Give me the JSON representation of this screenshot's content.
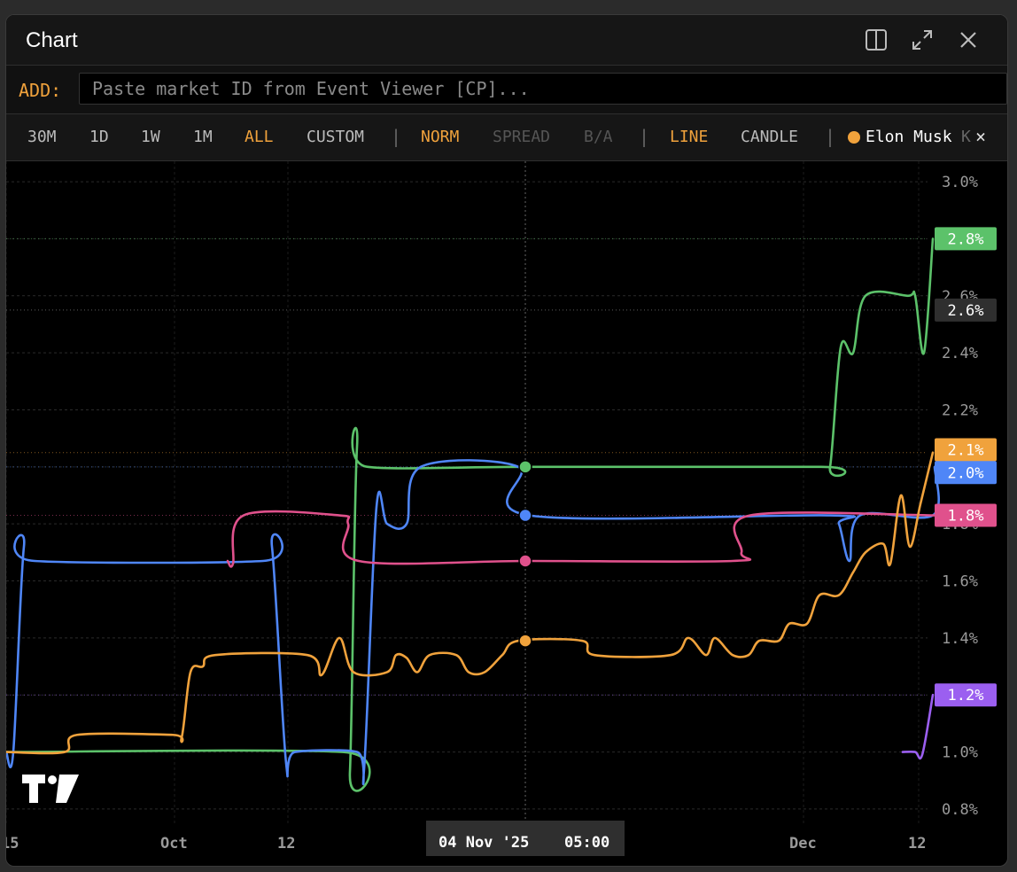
{
  "window": {
    "title": "Chart"
  },
  "icons": {
    "split": "split-view-icon",
    "expand": "expand-icon",
    "close": "close-icon"
  },
  "add_bar": {
    "label": "ADD:",
    "placeholder": "Paste market ID from Event Viewer [CP]..."
  },
  "toolbar": {
    "ranges": [
      "30M",
      "1D",
      "1W",
      "1M",
      "ALL",
      "CUSTOM"
    ],
    "active_range": "ALL",
    "modes": [
      "NORM",
      "SPREAD",
      "B/A"
    ],
    "active_mode": "NORM",
    "styles": [
      "LINE",
      "CANDLE"
    ],
    "active_style": "LINE",
    "separator": "|",
    "market_chip": {
      "label": "Elon Musk",
      "extra": "K",
      "close": "×",
      "color": "#f0a23c"
    }
  },
  "chart_data": {
    "type": "line",
    "y_unit": "%",
    "ylim": [
      0.75,
      3.05
    ],
    "y_ticks": [
      "3.0%",
      "2.8%",
      "2.6%",
      "2.4%",
      "2.2%",
      "2.0%",
      "1.8%",
      "1.6%",
      "1.4%",
      "1.2%",
      "1.0%",
      "0.8%"
    ],
    "x_ticks": [
      "15",
      "Oct",
      "12",
      "Dec",
      "12"
    ],
    "grid": true,
    "crosshair_label": {
      "date": "04 Nov '25",
      "time": "05:00"
    },
    "logo": "TV",
    "series": [
      {
        "color": "#5cc26a",
        "last_label": "2.8%",
        "points": [
          [
            0,
            1.0
          ],
          [
            380,
            1.0
          ],
          [
            388,
            0.93
          ],
          [
            396,
            2.07
          ],
          [
            408,
            2.0
          ],
          [
            590,
            2.0
          ],
          [
            920,
            2.0
          ],
          [
            930,
            2.0
          ],
          [
            942,
            2.42
          ],
          [
            956,
            2.4
          ],
          [
            970,
            2.6
          ],
          [
            1018,
            2.6
          ],
          [
            1026,
            2.6
          ],
          [
            1036,
            2.4
          ],
          [
            1046,
            2.8
          ]
        ]
      },
      {
        "color": "#4f86f7",
        "last_label": "2.0%",
        "points": [
          [
            0,
            1.0
          ],
          [
            8,
            1.0
          ],
          [
            20,
            1.72
          ],
          [
            32,
            1.67
          ],
          [
            290,
            1.67
          ],
          [
            300,
            1.72
          ],
          [
            316,
            0.96
          ],
          [
            326,
            1.0
          ],
          [
            396,
            1.0
          ],
          [
            404,
            0.94
          ],
          [
            418,
            1.86
          ],
          [
            430,
            1.8
          ],
          [
            452,
            1.8
          ],
          [
            468,
            2.0
          ],
          [
            578,
            2.0
          ],
          [
            590,
            1.83
          ],
          [
            930,
            1.83
          ],
          [
            940,
            1.8
          ],
          [
            952,
            1.67
          ],
          [
            964,
            1.83
          ],
          [
            1046,
            1.83
          ],
          [
            1048,
            2.0
          ]
        ]
      },
      {
        "color": "#e0518c",
        "last_label": "1.8%",
        "points": [
          [
            250,
            1.67
          ],
          [
            256,
            1.66
          ],
          [
            268,
            1.83
          ],
          [
            376,
            1.83
          ],
          [
            386,
            1.8
          ],
          [
            398,
            1.67
          ],
          [
            590,
            1.67
          ],
          [
            820,
            1.67
          ],
          [
            830,
            1.7
          ],
          [
            840,
            1.83
          ],
          [
            1048,
            1.83
          ]
        ]
      },
      {
        "color": "#f0a23c",
        "last_label": "2.1%",
        "points": [
          [
            0,
            1.0
          ],
          [
            66,
            1.0
          ],
          [
            80,
            1.06
          ],
          [
            188,
            1.06
          ],
          [
            198,
            1.05
          ],
          [
            208,
            1.28
          ],
          [
            222,
            1.3
          ],
          [
            236,
            1.34
          ],
          [
            340,
            1.34
          ],
          [
            356,
            1.27
          ],
          [
            376,
            1.4
          ],
          [
            392,
            1.28
          ],
          [
            430,
            1.28
          ],
          [
            440,
            1.34
          ],
          [
            452,
            1.33
          ],
          [
            464,
            1.28
          ],
          [
            478,
            1.34
          ],
          [
            508,
            1.34
          ],
          [
            522,
            1.28
          ],
          [
            540,
            1.28
          ],
          [
            560,
            1.34
          ],
          [
            578,
            1.39
          ],
          [
            650,
            1.39
          ],
          [
            664,
            1.34
          ],
          [
            750,
            1.34
          ],
          [
            770,
            1.4
          ],
          [
            790,
            1.34
          ],
          [
            800,
            1.4
          ],
          [
            820,
            1.34
          ],
          [
            838,
            1.34
          ],
          [
            850,
            1.39
          ],
          [
            872,
            1.39
          ],
          [
            884,
            1.45
          ],
          [
            904,
            1.45
          ],
          [
            918,
            1.55
          ],
          [
            940,
            1.55
          ],
          [
            956,
            1.63
          ],
          [
            970,
            1.7
          ],
          [
            990,
            1.73
          ],
          [
            998,
            1.66
          ],
          [
            1010,
            1.9
          ],
          [
            1020,
            1.72
          ],
          [
            1032,
            1.87
          ],
          [
            1046,
            2.05
          ]
        ]
      },
      {
        "color": "#9b5ff0",
        "last_label": "1.2%",
        "points": [
          [
            1012,
            1.0
          ],
          [
            1026,
            1.0
          ],
          [
            1034,
            0.99
          ],
          [
            1046,
            1.2
          ]
        ]
      }
    ],
    "crosshair_markers": [
      {
        "color": "#5cc26a",
        "value": 2.0
      },
      {
        "color": "#4f86f7",
        "value": 1.83
      },
      {
        "color": "#e0518c",
        "value": 1.67
      },
      {
        "color": "#f0a23c",
        "value": 1.39
      }
    ],
    "price_labels": [
      {
        "text": "2.8%",
        "value": 2.8,
        "bg": "#5cc26a",
        "fg": "#ffffff"
      },
      {
        "text": "2.6%",
        "value": 2.55,
        "bg": "#2f2f2f",
        "fg": "#ffffff"
      },
      {
        "text": "2.1%",
        "value": 2.06,
        "bg": "#f0a23c",
        "fg": "#ffffff"
      },
      {
        "text": "2.0%",
        "value": 1.98,
        "bg": "#4f86f7",
        "fg": "#ffffff"
      },
      {
        "text": "1.8%",
        "value": 1.83,
        "bg": "#e0518c",
        "fg": "#ffffff"
      },
      {
        "text": "1.2%",
        "value": 1.2,
        "bg": "#9b5ff0",
        "fg": "#ffffff"
      }
    ]
  }
}
